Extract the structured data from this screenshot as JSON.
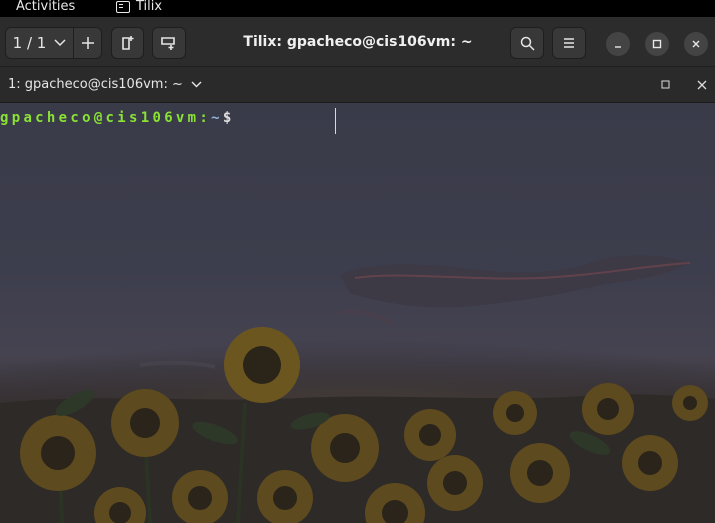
{
  "top_bar": {
    "activities": "Activities",
    "app_name": "Tilix",
    "app_icon": "terminal-app-icon"
  },
  "header_bar": {
    "session_counter": "1 / 1",
    "add_session_icon": "plus-icon",
    "split_right_icon": "split-horizontal-icon",
    "split_down_icon": "split-vertical-icon",
    "title": "Tilix: gpacheco@cis106vm: ~",
    "search_icon": "search-icon",
    "menu_icon": "hamburger-menu-icon",
    "minimize_icon": "minimize-icon",
    "maximize_icon": "maximize-icon",
    "close_icon": "close-icon"
  },
  "terminal_tab": {
    "title": "1: gpacheco@cis106vm: ~",
    "dropdown_icon": "chevron-down-icon",
    "maximize_icon": "maximize-icon",
    "close_icon": "close-icon"
  },
  "terminal": {
    "prompt_user_host": "gpacheco@cis106vm:",
    "prompt_path": "~",
    "prompt_symbol": "$",
    "user_color": "#8ae234",
    "path_color": "#8fb4d8"
  }
}
